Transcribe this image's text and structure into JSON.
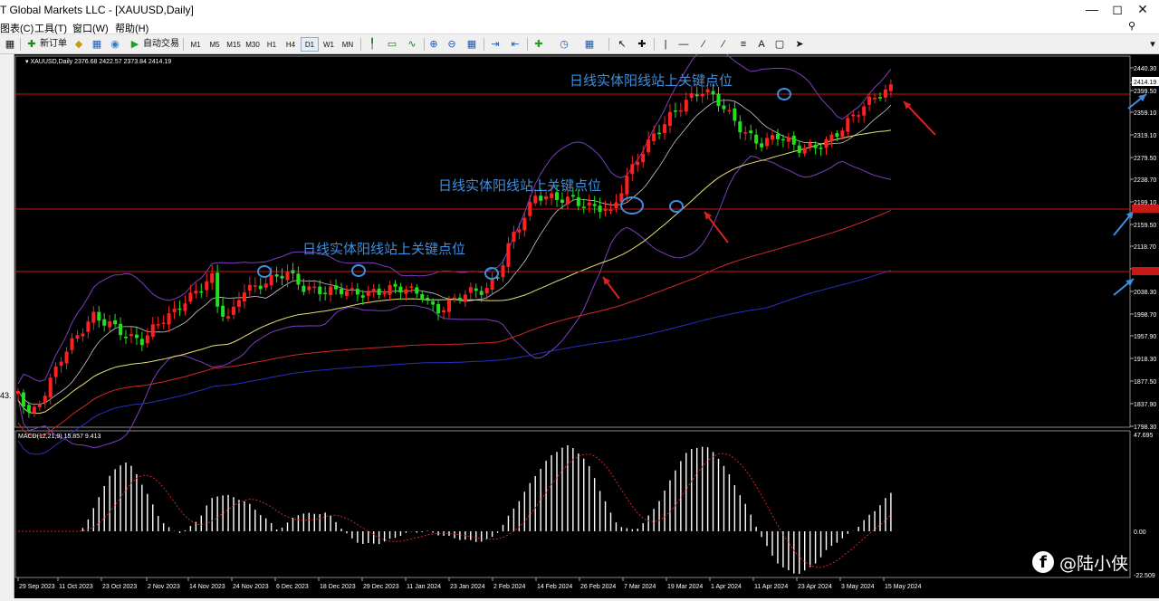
{
  "window": {
    "title": "T Global Markets LLC - [XAUUSD,Daily]"
  },
  "menu": [
    {
      "label": "图表(C)"
    },
    {
      "label": "工具(T)"
    },
    {
      "label": "窗口(W)"
    },
    {
      "label": "帮助(H)"
    }
  ],
  "toolbar": {
    "new_order": "新订单",
    "auto_trade": "自动交易",
    "periods": [
      "M1",
      "M5",
      "M15",
      "M30",
      "H1",
      "H4",
      "D1",
      "W1",
      "MN"
    ],
    "active_period": "D1",
    "text_tool": "A"
  },
  "chart": {
    "header": "XAUUSD,Daily  2376.68 2422.57 2373.84 2414.19",
    "y_ticks": [
      "2440.30",
      "2414.19",
      "2399.50",
      "2359.10",
      "2319.10",
      "2279.50",
      "2238.70",
      "2199.10",
      "2159.50",
      "2118.70",
      "2079.10",
      "2038.30",
      "1998.70",
      "1957.90",
      "1918.30",
      "1877.50",
      "1837.90",
      "1798.30"
    ],
    "current_price_label": "2414.19",
    "colors": {
      "up": "#ff2020",
      "down": "#20e020",
      "background": "#000000",
      "level_line": "#c81818",
      "annotation": "#3d8fe0",
      "arrow": "#e02020"
    },
    "annotations": [
      {
        "text": "日线实体阳线站上关键点位"
      },
      {
        "text": "日线实体阳线站上关键点位"
      },
      {
        "text": "日线实体阳线站上关键点位"
      }
    ]
  },
  "macd": {
    "header": "MACD(12,21,9) 15.857 9.413",
    "y_ticks": [
      "47.695",
      "0.00",
      "-22.509"
    ]
  },
  "x_ticks": [
    "29 Sep 2023",
    "11 Oct 2023",
    "23 Oct 2023",
    "2 Nov 2023",
    "14 Nov 2023",
    "24 Nov 2023",
    "6 Dec 2023",
    "18 Dec 2023",
    "29 Dec 2023",
    "11 Jan 2024",
    "23 Jan 2024",
    "2 Feb 2024",
    "14 Feb 2024",
    "26 Feb 2024",
    "7 Mar 2024",
    "19 Mar 2024",
    "1 Apr 2024",
    "11 Apr 2024",
    "23 Apr 2024",
    "3 May 2024",
    "15 May 2024"
  ],
  "left_strip_label": "43.",
  "watermark": {
    "text": "@陆小侠"
  }
}
